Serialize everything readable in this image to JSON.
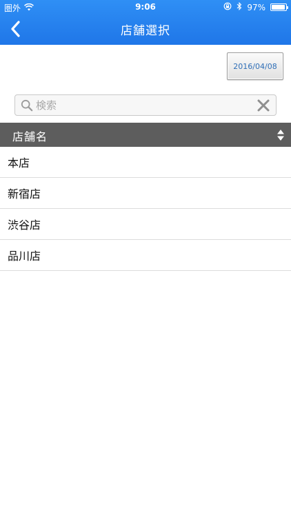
{
  "status_bar": {
    "carrier": "圏外",
    "time": "9:06",
    "battery_percent": 97,
    "battery_label": "97%"
  },
  "nav": {
    "title": "店舗選択"
  },
  "date_button": {
    "label": "2016/04/08"
  },
  "search": {
    "placeholder": "検索",
    "value": ""
  },
  "list": {
    "header": "店舗名",
    "items": [
      {
        "label": "本店"
      },
      {
        "label": "新宿店"
      },
      {
        "label": "渋谷店"
      },
      {
        "label": "品川店"
      }
    ]
  },
  "icons": {
    "back": "chevron-left-icon",
    "search": "search-icon",
    "clear": "clear-icon",
    "sort": "sort-icon",
    "wifi": "wifi-icon",
    "lock_rotation": "rotation-lock-icon",
    "bluetooth": "bluetooth-icon",
    "battery": "battery-icon"
  },
  "colors": {
    "header_top": "#2f8ff5",
    "header_bottom": "#1f76e8",
    "list_header_bg": "#5d5d5d",
    "date_text": "#2f6fb8"
  }
}
